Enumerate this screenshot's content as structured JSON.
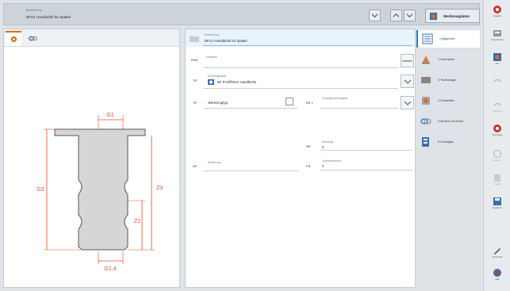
{
  "titlebar": {
    "label": "Bezeichnung",
    "value": "BFG1 Handkehle für Spalter",
    "workpiece_label": "Werkzeugdaten"
  },
  "left_panel": {
    "tabs": [
      {
        "name": "tool-tab",
        "icon": "circle-tool-icon"
      },
      {
        "name": "link-tab",
        "icon": "chain-link-icon"
      }
    ],
    "drawing_labels": {
      "g1": "G1",
      "g1_4": "G1.4",
      "g2": "G2",
      "g3": "G3",
      "z2": "Z2",
      "z3": "Z3"
    }
  },
  "form": {
    "name_label": "Bezeichnung",
    "name_value": "BFG1 Handkehle für Spalter",
    "row2_tag": "RNS",
    "row2_label": "Kategorie",
    "row2_btn": "Auswahl",
    "row3_tag": "TR",
    "row3_label": "Werkzeugklasse",
    "row3_value": "BF Profilfräser Handkehle",
    "row4_tag": "TP",
    "row4_value": "Werkzeugtyp",
    "row4_right_tag": "BS 1",
    "row4_right_label": "Schnittgeschwindigkeit",
    "row5_tag": "NR",
    "row5_label": "Nutzlänge",
    "row5_value": "0",
    "row6_tag": "AP",
    "row6_label": "Bemerkung",
    "row6_right_tag": "FN",
    "row6_right_label": "Schneidenanzahl",
    "row6_right_value": "0"
  },
  "nav": [
    {
      "label": "1 Allgemein",
      "icon": "list-icon",
      "active": true
    },
    {
      "label": "2 Geometrie",
      "icon": "geometry-icon",
      "active": false
    },
    {
      "label": "3 Technologie",
      "icon": "technology-icon",
      "active": false
    },
    {
      "label": "4 Schneiden",
      "icon": "blades-icon",
      "active": false
    },
    {
      "label": "5 Modell und Kolon",
      "icon": "model-icon",
      "active": false
    },
    {
      "label": "6 Sonstiges",
      "icon": "misc-icon",
      "active": false
    }
  ],
  "toolbar": [
    {
      "label": "Ausgabe",
      "icon": "gear-red-icon",
      "enabled": true
    },
    {
      "label": "Übernehmen",
      "icon": "apply-icon",
      "enabled": true
    },
    {
      "label": "Neu",
      "icon": "new-icon",
      "enabled": true
    },
    {
      "label": "",
      "icon": "undo-icon",
      "enabled": false
    },
    {
      "label": "Verwerfen",
      "icon": "undo2-icon",
      "enabled": false
    },
    {
      "label": "Übertragen",
      "icon": "transfer-icon",
      "enabled": true
    },
    {
      "label": "Einlesen",
      "icon": "load-icon",
      "enabled": false
    },
    {
      "label": "Drucken",
      "icon": "print-icon",
      "enabled": false
    },
    {
      "label": "Speichern",
      "icon": "save-icon",
      "enabled": true
    },
    {
      "label": "Kommentar",
      "icon": "edit-icon",
      "enabled": true
    },
    {
      "label": "Hilfe",
      "icon": "help-icon",
      "enabled": true
    }
  ],
  "colors": {
    "accent_orange": "#e06a1a",
    "accent_blue": "#2a7fc7",
    "dimension_red": "#e34b2a"
  }
}
